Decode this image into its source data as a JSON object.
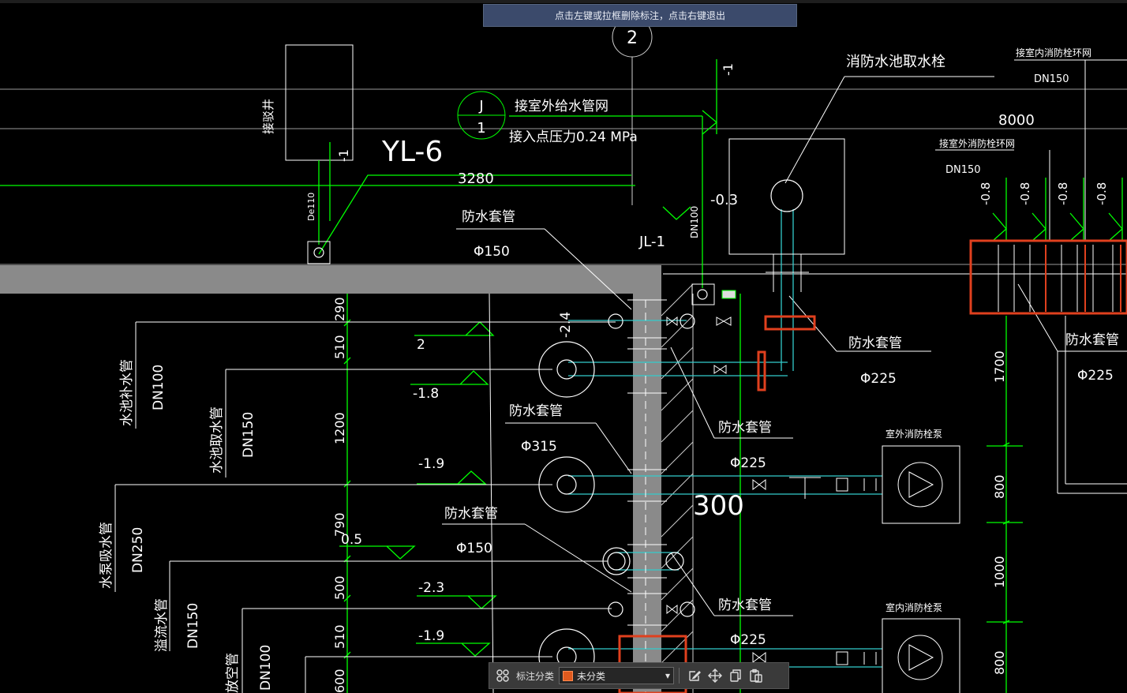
{
  "tooltip": "点击左键或拉框删除标注，点击右键退出",
  "toolbar": {
    "category_label": "标注分类",
    "category_value": "未分类",
    "icons": [
      "layout-grid-icon",
      "edit-icon",
      "move-icon",
      "copy-icon",
      "paste-icon"
    ]
  },
  "drawing": {
    "grid_axis_2": "2",
    "yl6": "YL-6",
    "j_top": "J",
    "j_bottom": "1",
    "outdoor_supply": "接室外给水管网",
    "supply_pressure": "接入点压力0.24 MPa",
    "dim_3280": "3280",
    "jl1": "JL-1",
    "manhole": "接驳井",
    "de110": "De110",
    "cut_minus1_a": "-1",
    "cut_minus1_b": "-1",
    "dn100_vert": "DN100",
    "elev_m03": "-0.3",
    "tank_hydrant": "消防水池取水栓",
    "indoor_ring": "接室内消防栓环网",
    "dn150_a": "DN150",
    "dim_8000": "8000",
    "outdoor_ring": "接室外消防栓环网",
    "dn150_b": "DN150",
    "elev_m08": "-0.8",
    "sleeve": "防水套管",
    "phi150": "Φ150",
    "phi225": "Φ225",
    "phi315": "Φ315",
    "elev_m24": "-2.4",
    "elev_2": "2",
    "elev_m18": "-1.8",
    "elev_m19": "-1.9",
    "elev_05": "0.5",
    "elev_m23": "-2.3",
    "dim_300": "300",
    "dim_290": "290",
    "dim_510": "510",
    "dim_1200": "1200",
    "dim_790": "790",
    "dim_500": "500",
    "dim_600": "600",
    "dim_1700": "1700",
    "dim_800": "800",
    "dim_1000": "1000",
    "pipe_makeup": "水池补水管",
    "pipe_makeup_dn": "DN100",
    "pipe_take": "水池取水管",
    "pipe_take_dn": "DN150",
    "pipe_suction": "水泵吸水管",
    "pipe_suction_dn": "DN250",
    "pipe_overflow": "溢流水管",
    "pipe_overflow_dn": "DN150",
    "pipe_drain": "放空管",
    "pipe_drain_dn": "DN100",
    "pump_outdoor": "室外消防栓泵",
    "pump_indoor": "室内消防栓泵"
  },
  "colors": {
    "text": "#ffffff",
    "pipe_green": "#00ff00",
    "pipe_cyan": "#33cccc",
    "wall": "#8a8a8a",
    "highlight": "#e0401e"
  }
}
